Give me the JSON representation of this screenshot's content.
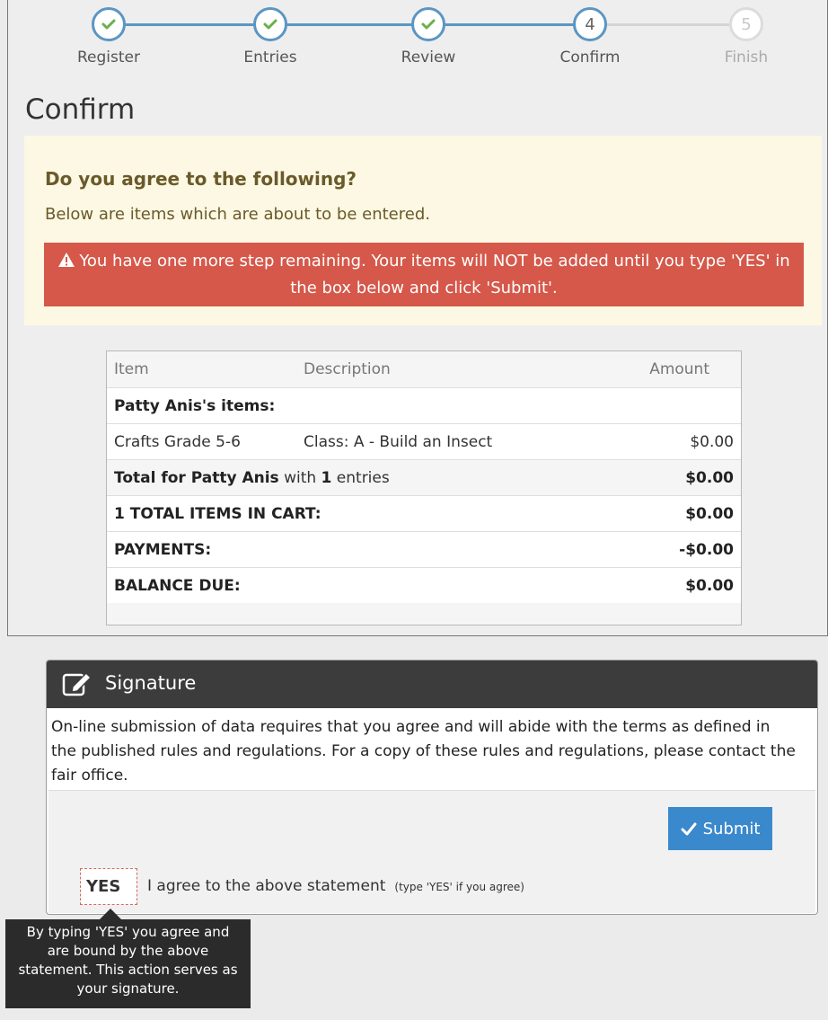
{
  "steps": [
    {
      "label": "Register",
      "state": "done"
    },
    {
      "label": "Entries",
      "state": "done"
    },
    {
      "label": "Review",
      "state": "done"
    },
    {
      "label": "Confirm",
      "state": "current",
      "number": "4"
    },
    {
      "label": "Finish",
      "state": "pending",
      "number": "5"
    }
  ],
  "page_title": "Confirm",
  "agree": {
    "title": "Do you agree to the following?",
    "subtitle": "Below are items which are about to be entered.",
    "alert": "You have one more step remaining. Your items will NOT be added until you type 'YES' in the box below and click 'Submit'."
  },
  "table": {
    "headers": {
      "item": "Item",
      "description": "Description",
      "amount": "Amount"
    },
    "owner_label": "Patty Anis's items:",
    "entry": {
      "item": "Crafts Grade 5-6",
      "description": "Class: A - Build an Insect",
      "amount": "$0.00"
    },
    "total_for": {
      "prefix": "Total for Patty Anis",
      "mid": " with ",
      "count": "1",
      "suffix": " entries",
      "amount": "$0.00"
    },
    "cart_total": {
      "label": "1 TOTAL ITEMS IN CART:",
      "amount": "$0.00"
    },
    "payments": {
      "label": "PAYMENTS:",
      "amount": "-$0.00"
    },
    "balance": {
      "label": "BALANCE DUE:",
      "amount": "$0.00"
    }
  },
  "signature": {
    "title": "Signature",
    "text": "On-line submission of data requires that you agree and will abide with the terms as defined in the published rules and regulations. For a copy of these rules and regulations, please contact the fair office.",
    "submit_label": "Submit",
    "input_value": "YES",
    "agree_label": "I agree to the above statement",
    "agree_hint": "(type 'YES' if you agree)",
    "tooltip": "By typing 'YES' you agree and are bound by the above statement. This action serves as your signature."
  },
  "colors": {
    "step_blue": "#5b96c3",
    "check_green": "#6ab04c",
    "alert_red": "#d5584a",
    "submit_blue": "#3a89cd"
  }
}
